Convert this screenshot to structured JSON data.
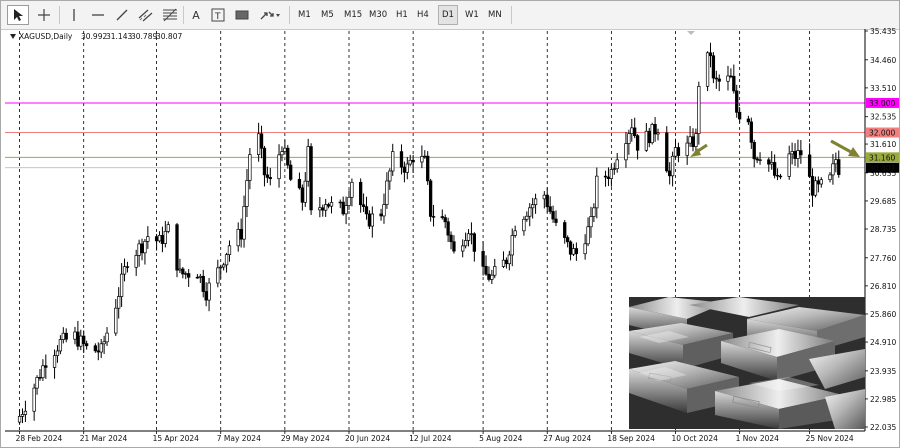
{
  "toolbar": {
    "tools": [
      {
        "name": "cursor-icon",
        "active": true
      },
      {
        "name": "crosshair-icon",
        "active": false
      },
      {
        "name": "vertical-line-icon",
        "active": false
      },
      {
        "name": "horizontal-line-icon",
        "active": false
      },
      {
        "name": "trend-line-icon",
        "active": false
      },
      {
        "name": "equidistant-channel-icon",
        "active": false
      },
      {
        "name": "fibonacci-retracement-icon",
        "active": false
      },
      {
        "name": "text-icon",
        "label": "A"
      },
      {
        "name": "text-label-icon",
        "label": "T"
      },
      {
        "name": "rectangle-icon"
      },
      {
        "name": "arrows-icon"
      }
    ],
    "timeframes": [
      "M1",
      "M5",
      "M15",
      "M30",
      "H1",
      "H4",
      "D1",
      "W1",
      "MN"
    ],
    "selected_timeframe": "D1"
  },
  "chart_header": {
    "symbol": "XAGUSD,Daily",
    "open": "30.992",
    "high": "31.143",
    "low": "30.789",
    "close": "30.807"
  },
  "chart_data": {
    "type": "candlestick",
    "symbol": "XAGUSD",
    "timeframe": "Daily",
    "y_ticks": [
      "35.435",
      "34.460",
      "33.510",
      "32.535",
      "31.610",
      "30.635",
      "29.685",
      "28.735",
      "27.760",
      "26.810",
      "25.860",
      "24.910",
      "23.935",
      "22.985",
      "22.035"
    ],
    "ylim": [
      22.035,
      35.435
    ],
    "x_tick_labels": [
      "28 Feb 2024",
      "21 Mar 2024",
      "15 Apr 2024",
      "7 May 2024",
      "29 May 2024",
      "20 Jun 2024",
      "12 Jul 2024",
      "5 Aug 2024",
      "27 Aug 2024",
      "18 Sep 2024",
      "10 Oct 2024",
      "1 Nov 2024",
      "25 Nov 2024"
    ],
    "xlim": [
      "2024-02-23",
      "2024-12-14"
    ],
    "x_ticks": [
      "2024-02-28",
      "2024-03-21",
      "2024-04-15",
      "2024-05-07",
      "2024-05-29",
      "2024-06-20",
      "2024-07-12",
      "2024-08-05",
      "2024-08-27",
      "2024-09-18",
      "2024-10-10",
      "2024-11-01",
      "2024-11-25"
    ],
    "grid": {
      "vertical_dashed": true,
      "horizontal": false
    },
    "candle_color": "#000000",
    "series": [
      {
        "date": "2024-02-28",
        "close": 22.4
      },
      {
        "date": "2024-03-04",
        "close": 23.4
      },
      {
        "date": "2024-03-08",
        "close": 24.3
      },
      {
        "date": "2024-03-13",
        "close": 24.9
      },
      {
        "date": "2024-03-18",
        "close": 25.1
      },
      {
        "date": "2024-03-22",
        "close": 24.7
      },
      {
        "date": "2024-03-27",
        "close": 24.6
      },
      {
        "date": "2024-04-01",
        "close": 26.2
      },
      {
        "date": "2024-04-05",
        "close": 27.7
      },
      {
        "date": "2024-04-10",
        "close": 28.2
      },
      {
        "date": "2024-04-12",
        "close": 28.5
      },
      {
        "date": "2024-04-16",
        "close": 28.3
      },
      {
        "date": "2024-04-19",
        "close": 28.7
      },
      {
        "date": "2024-04-23",
        "close": 27.2
      },
      {
        "date": "2024-04-29",
        "close": 27.3
      },
      {
        "date": "2024-05-02",
        "close": 26.6
      },
      {
        "date": "2024-05-06",
        "close": 27.3
      },
      {
        "date": "2024-05-10",
        "close": 28.2
      },
      {
        "date": "2024-05-14",
        "close": 28.6
      },
      {
        "date": "2024-05-17",
        "close": 31.3
      },
      {
        "date": "2024-05-20",
        "close": 31.8
      },
      {
        "date": "2024-05-22",
        "close": 30.6
      },
      {
        "date": "2024-05-24",
        "close": 30.3
      },
      {
        "date": "2024-05-28",
        "close": 31.6
      },
      {
        "date": "2024-05-31",
        "close": 30.4
      },
      {
        "date": "2024-06-04",
        "close": 29.7
      },
      {
        "date": "2024-06-06",
        "close": 31.3
      },
      {
        "date": "2024-06-07",
        "close": 29.2
      },
      {
        "date": "2024-06-12",
        "close": 29.7
      },
      {
        "date": "2024-06-14",
        "close": 29.5
      },
      {
        "date": "2024-06-18",
        "close": 29.4
      },
      {
        "date": "2024-06-21",
        "close": 30.4
      },
      {
        "date": "2024-06-26",
        "close": 29.0
      },
      {
        "date": "2024-07-01",
        "close": 29.3
      },
      {
        "date": "2024-07-05",
        "close": 31.1
      },
      {
        "date": "2024-07-10",
        "close": 30.8
      },
      {
        "date": "2024-07-12",
        "close": 31.2
      },
      {
        "date": "2024-07-16",
        "close": 31.0
      },
      {
        "date": "2024-07-18",
        "close": 29.3
      },
      {
        "date": "2024-07-23",
        "close": 29.0
      },
      {
        "date": "2024-07-26",
        "close": 27.9
      },
      {
        "date": "2024-07-31",
        "close": 28.8
      },
      {
        "date": "2024-08-05",
        "close": 27.2
      },
      {
        "date": "2024-08-08",
        "close": 27.1
      },
      {
        "date": "2024-08-13",
        "close": 27.7
      },
      {
        "date": "2024-08-16",
        "close": 28.9
      },
      {
        "date": "2024-08-21",
        "close": 29.5
      },
      {
        "date": "2024-08-26",
        "close": 29.9
      },
      {
        "date": "2024-08-30",
        "close": 28.8
      },
      {
        "date": "2024-09-04",
        "close": 28.0
      },
      {
        "date": "2024-09-06",
        "close": 27.9
      },
      {
        "date": "2024-09-11",
        "close": 28.9
      },
      {
        "date": "2024-09-13",
        "close": 30.3
      },
      {
        "date": "2024-09-18",
        "close": 30.7
      },
      {
        "date": "2024-09-20",
        "close": 31.3
      },
      {
        "date": "2024-09-25",
        "close": 32.3
      },
      {
        "date": "2024-09-27",
        "close": 31.6
      },
      {
        "date": "2024-10-02",
        "close": 32.0
      },
      {
        "date": "2024-10-04",
        "close": 32.2
      },
      {
        "date": "2024-10-08",
        "close": 30.5
      },
      {
        "date": "2024-10-10",
        "close": 31.4
      },
      {
        "date": "2024-10-14",
        "close": 31.5
      },
      {
        "date": "2024-10-17",
        "close": 31.8
      },
      {
        "date": "2024-10-18",
        "close": 33.7
      },
      {
        "date": "2024-10-22",
        "close": 34.7
      },
      {
        "date": "2024-10-23",
        "close": 33.7
      },
      {
        "date": "2024-10-25",
        "close": 33.7
      },
      {
        "date": "2024-10-29",
        "close": 33.8
      },
      {
        "date": "2024-10-31",
        "close": 32.7
      },
      {
        "date": "2024-11-04",
        "close": 32.5
      },
      {
        "date": "2024-11-06",
        "close": 31.2
      },
      {
        "date": "2024-11-08",
        "close": 31.3
      },
      {
        "date": "2024-11-12",
        "close": 30.8
      },
      {
        "date": "2024-11-14",
        "close": 30.3
      },
      {
        "date": "2024-11-18",
        "close": 31.2
      },
      {
        "date": "2024-11-20",
        "close": 31.2
      },
      {
        "date": "2024-11-22",
        "close": 31.3
      },
      {
        "date": "2024-11-26",
        "close": 30.1
      },
      {
        "date": "2024-11-28",
        "close": 30.1
      },
      {
        "date": "2024-12-02",
        "close": 30.4
      },
      {
        "date": "2024-12-04",
        "close": 31.1
      },
      {
        "date": "2024-12-05",
        "close": 30.8
      }
    ],
    "levels": [
      {
        "label": "33.000",
        "value": 33.0,
        "color": "#ff00ff"
      },
      {
        "label": "32.000",
        "value": 32.0,
        "color": "#f08080"
      },
      {
        "label": "31.160",
        "value": 31.16,
        "color": "#9aab3c"
      },
      {
        "label": "30.807",
        "value": 30.807,
        "color": "#b0b0b0",
        "current_price": true
      }
    ],
    "annotations": [
      {
        "type": "arrow",
        "color": "#7f8232",
        "pointing": "down-left at last candle"
      },
      {
        "type": "arrow",
        "color": "#7f8232",
        "pointing": "down-right toward price axis"
      }
    ]
  },
  "inset_image": {
    "name": "silver-bars-image",
    "description_visible": false
  }
}
